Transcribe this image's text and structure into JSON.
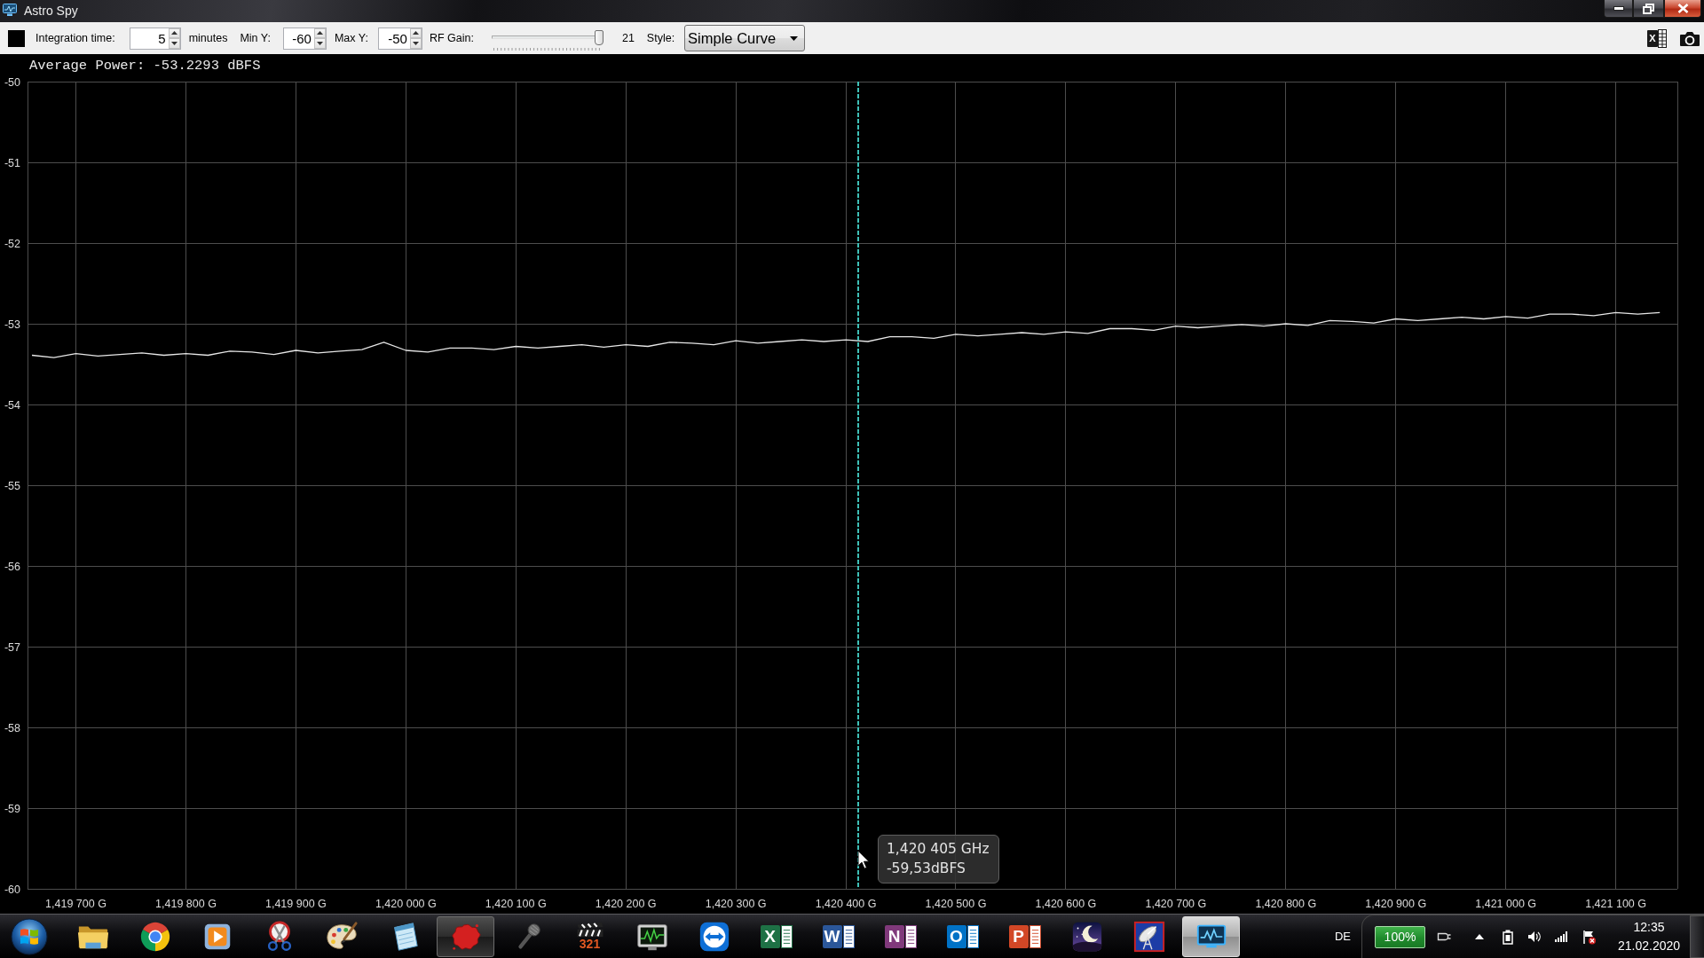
{
  "window": {
    "title": "Astro Spy"
  },
  "toolbar": {
    "integration_time": {
      "label": "Integration time:",
      "value": "5",
      "unit": "minutes"
    },
    "min_y": {
      "label": "Min Y:",
      "value": "-60"
    },
    "max_y": {
      "label": "Max Y:",
      "value": "-50"
    },
    "rf_gain": {
      "label": "RF Gain:",
      "level": 1,
      "reading": "21"
    },
    "style": {
      "label": "Style:",
      "value": "Simple Curve"
    },
    "export_button": {
      "letter": "X"
    }
  },
  "chart": {
    "readout": "Average Power: -53.2293 dBFS",
    "chart_data": {
      "type": "line",
      "grid": true,
      "ylim": [
        -60,
        -50
      ],
      "yticks": [
        -60,
        -59,
        -58,
        -57,
        -56,
        -55,
        -54,
        -53,
        -52,
        -51,
        -50
      ],
      "categories": [
        null,
        null,
        "1,419 700 G",
        null,
        null,
        null,
        null,
        "1,419 800 G",
        null,
        null,
        null,
        null,
        "1,419 900 G",
        null,
        null,
        null,
        null,
        "1,420 000 G",
        null,
        null,
        null,
        null,
        "1,420 100 G",
        null,
        null,
        null,
        null,
        "1,420 200 G",
        null,
        null,
        null,
        null,
        "1,420 300 G",
        null,
        null,
        null,
        null,
        "1,420 400 G",
        null,
        null,
        null,
        null,
        "1,420 500 G",
        null,
        null,
        null,
        null,
        "1,420 600 G",
        null,
        null,
        null,
        null,
        "1,420 700 G",
        null,
        null,
        null,
        null,
        "1,420 800 G",
        null,
        null,
        null,
        null,
        "1,420 900 G",
        null,
        null,
        null,
        null,
        "1,421 000 G",
        null,
        null,
        null,
        null,
        "1,421 100 G",
        null,
        null
      ],
      "series": [
        {
          "color": "#e6e6e6",
          "values": [
            -53.39,
            -53.42,
            -53.37,
            -53.4,
            -53.38,
            -53.36,
            -53.39,
            -53.37,
            -53.39,
            -53.34,
            -53.35,
            -53.38,
            -53.33,
            -53.36,
            -53.34,
            -53.32,
            -53.23,
            -53.33,
            -53.35,
            -53.3,
            -53.3,
            -53.32,
            -53.28,
            -53.3,
            -53.28,
            -53.26,
            -53.29,
            -53.26,
            -53.28,
            -53.23,
            -53.24,
            -53.26,
            -53.21,
            -53.24,
            -53.22,
            -53.2,
            -53.22,
            -53.2,
            -53.22,
            -53.16,
            -53.16,
            -53.18,
            -53.13,
            -53.15,
            -53.13,
            -53.11,
            -53.13,
            -53.1,
            -53.12,
            -53.06,
            -53.06,
            -53.08,
            -53.03,
            -53.05,
            -53.03,
            -53.01,
            -53.03,
            -53.0,
            -53.02,
            -52.96,
            -52.97,
            -52.99,
            -52.94,
            -52.96,
            -52.94,
            -52.92,
            -52.94,
            -52.91,
            -52.93,
            -52.88,
            -52.88,
            -52.9,
            -52.86,
            -52.88,
            -52.86
          ]
        }
      ],
      "annotations": [
        {
          "text": [
            "1,420 405 GHz",
            "-59,53dBFS"
          ]
        }
      ]
    }
  },
  "taskbar": {
    "apps": [
      {
        "kind": "folder",
        "running": false,
        "selected": false
      },
      {
        "kind": "tricolor",
        "running": false,
        "selected": false
      },
      {
        "kind": "player",
        "running": false,
        "selected": false
      },
      {
        "kind": "scissors",
        "running": false,
        "selected": false
      },
      {
        "kind": "palette",
        "running": false,
        "selected": false
      },
      {
        "kind": "notepad",
        "running": false,
        "selected": false
      },
      {
        "kind": "splat",
        "running": true,
        "selected": false
      },
      {
        "kind": "microphone",
        "running": false,
        "selected": false
      },
      {
        "kind": "clapper",
        "caption": "321",
        "running": false,
        "selected": false
      },
      {
        "kind": "monitor",
        "running": false,
        "selected": false
      },
      {
        "kind": "remote",
        "running": false,
        "selected": false
      },
      {
        "kind": "letter",
        "letter": "X",
        "color": "#1e7145",
        "running": false,
        "selected": false
      },
      {
        "kind": "letter",
        "letter": "W",
        "color": "#2b579a",
        "running": false,
        "selected": false
      },
      {
        "kind": "letter",
        "letter": "N",
        "color": "#80397b",
        "running": false,
        "selected": false
      },
      {
        "kind": "letter",
        "letter": "O",
        "color": "#0072c6",
        "running": false,
        "selected": false
      },
      {
        "kind": "letter",
        "letter": "P",
        "color": "#d24726",
        "running": false,
        "selected": false
      },
      {
        "kind": "moon",
        "running": false,
        "selected": false
      },
      {
        "kind": "dish",
        "running": false,
        "selected": false
      },
      {
        "kind": "scope",
        "running": true,
        "selected": true
      }
    ],
    "tray": {
      "language": "DE",
      "battery": "100%",
      "time": "12:35",
      "date": "21.02.2020"
    }
  }
}
